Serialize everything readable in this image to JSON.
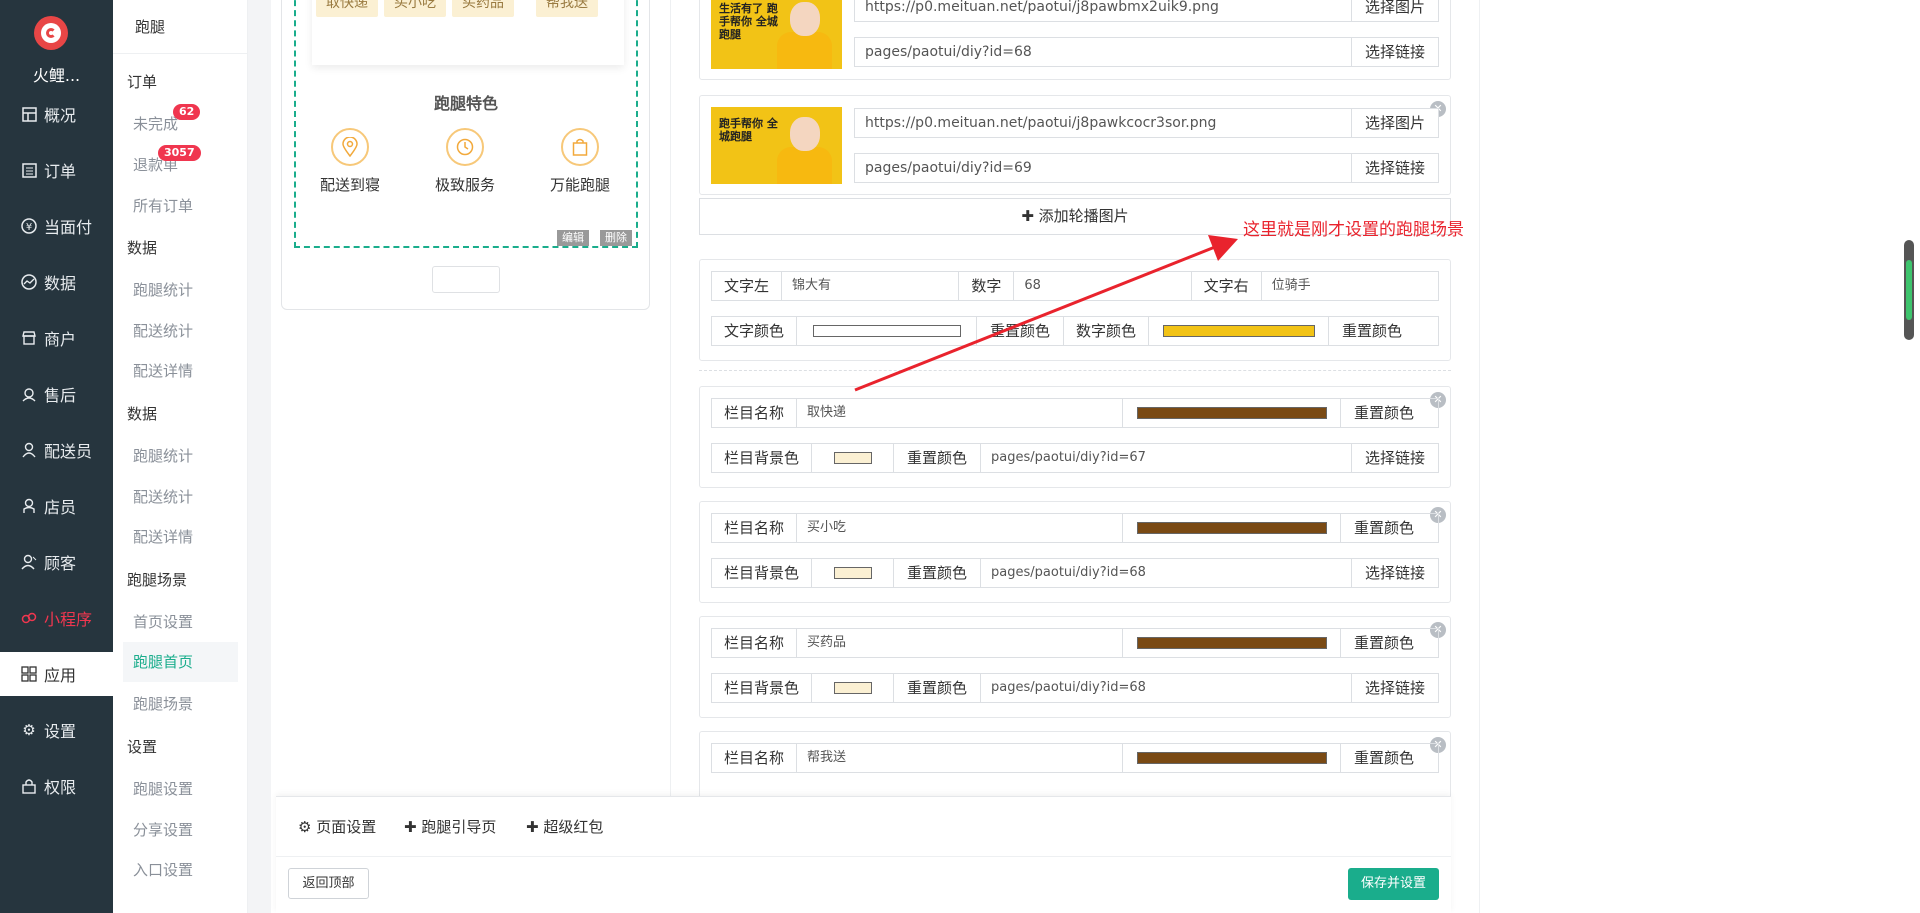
{
  "brand": "火鲤...",
  "nav": [
    {
      "label": "概况",
      "icon": "grid-icon"
    },
    {
      "label": "订单",
      "icon": "list-icon"
    },
    {
      "label": "当面付",
      "icon": "yen-icon"
    },
    {
      "label": "数据",
      "icon": "chart-icon"
    },
    {
      "label": "商户",
      "icon": "store-icon"
    },
    {
      "label": "售后",
      "icon": "headset-icon"
    },
    {
      "label": "配送员",
      "icon": "user-icon"
    },
    {
      "label": "店员",
      "icon": "user-icon"
    },
    {
      "label": "顾客",
      "icon": "users-icon"
    },
    {
      "label": "小程序",
      "icon": "miniapp-icon"
    },
    {
      "label": "应用",
      "icon": "apps-icon"
    },
    {
      "label": "设置",
      "icon": "gear-icon"
    },
    {
      "label": "权限",
      "icon": "lock-icon"
    }
  ],
  "subnav": {
    "top": "跑腿",
    "groups": [
      {
        "title": "订单",
        "items": [
          "未完成",
          "退款单",
          "所有订单"
        ]
      },
      {
        "title": "数据",
        "items": [
          "跑腿统计",
          "配送统计",
          "配送详情"
        ]
      },
      {
        "title": "数据",
        "items": [
          "跑腿统计",
          "配送统计",
          "配送详情"
        ]
      },
      {
        "title": "跑腿场景",
        "items": [
          "首页设置",
          "跑腿首页",
          "跑腿场景"
        ]
      },
      {
        "title": "设置",
        "items": [
          "跑腿设置",
          "分享设置",
          "入口设置"
        ]
      }
    ],
    "badges": {
      "pending": "62",
      "refund": "3057"
    }
  },
  "preview": {
    "tags": [
      "取快递",
      "买小吃",
      "买药品",
      "帮我送"
    ],
    "feature_title": "跑腿特色",
    "features": [
      "配送到寝",
      "极致服务",
      "万能跑腿"
    ],
    "edit": "编辑",
    "delete": "删除"
  },
  "banners": [
    {
      "image": "https://p0.meituan.net/paotui/j8pawbmx2uik9.png",
      "link": "pages/paotui/diy?id=68",
      "alt_text": "生活有了 跑手帮你 全城跑腿"
    },
    {
      "image": "https://p0.meituan.net/paotui/j8pawkcocr3sor.png",
      "link": "pages/paotui/diy?id=69",
      "alt_text": "跑手帮你 全城跑腿"
    }
  ],
  "buttons": {
    "choose_image": "选择图片",
    "choose_link": "选择链接",
    "reset_color": "重置颜色",
    "add_banner": "添加轮播图片"
  },
  "stats": {
    "text_left_label": "文字左",
    "text_left": "锦大有",
    "number_label": "数字",
    "number": "68",
    "text_right_label": "文字右",
    "text_right": "位骑手",
    "text_color_label": "文字颜色",
    "number_color_label": "数字颜色",
    "text_color": "#ffffff",
    "number_color": "#f2c316"
  },
  "columns": [
    {
      "name": "取快递",
      "link": "pages/paotui/diy?id=67"
    },
    {
      "name": "买小吃",
      "link": "pages/paotui/diy?id=68"
    },
    {
      "name": "买药品",
      "link": "pages/paotui/diy?id=68"
    },
    {
      "name": "帮我送",
      "link": ""
    }
  ],
  "column_labels": {
    "name": "栏目名称",
    "bg": "栏目背景色"
  },
  "colors": {
    "column_name": "#7a4a14",
    "column_bg": "#fbf0d3",
    "accent": "#1aad8c",
    "annotation": "#e9232d"
  },
  "annotation": "这里就是刚才设置的跑腿场景",
  "bottom": {
    "page_settings": "页面设置",
    "guide_page": "跑腿引导页",
    "red_packet": "超级红包",
    "back_top": "返回顶部",
    "save": "保存并设置"
  }
}
